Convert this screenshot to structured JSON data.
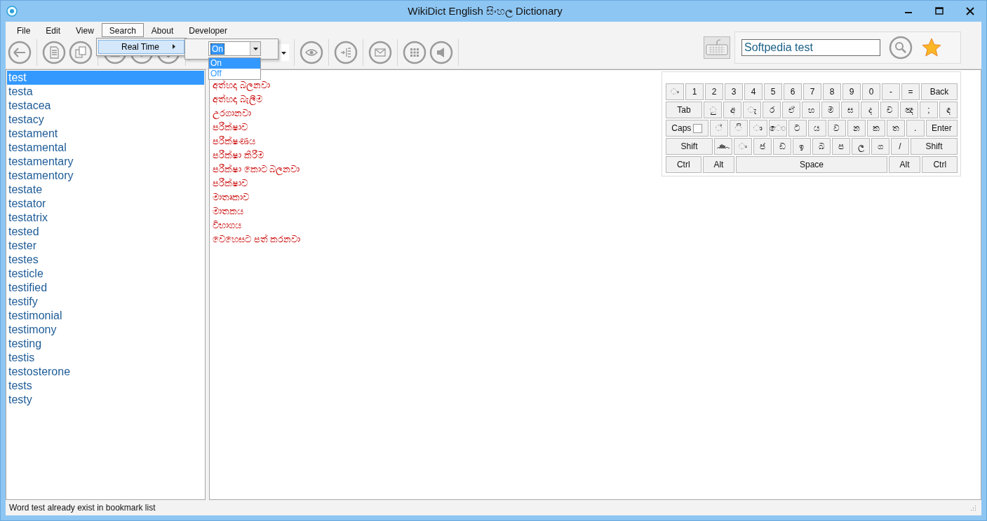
{
  "window": {
    "title": "WikiDict English සිංහල Dictionary"
  },
  "menu": [
    {
      "label": "File",
      "selected": false
    },
    {
      "label": "Edit",
      "selected": false
    },
    {
      "label": "View",
      "selected": false
    },
    {
      "label": "Search",
      "selected": true
    },
    {
      "label": "About",
      "selected": false
    },
    {
      "label": "Developer",
      "selected": false
    }
  ],
  "submenu": [
    {
      "label": "Real Time",
      "selected": true
    }
  ],
  "realtime_combo": {
    "value": "On",
    "options": [
      {
        "label": "On",
        "selected": true
      },
      {
        "label": "Off",
        "selected": false
      }
    ]
  },
  "search": {
    "value": "Softpedia test"
  },
  "words": [
    {
      "text": "test",
      "selected": true
    },
    {
      "text": "testa",
      "selected": false
    },
    {
      "text": "testacea",
      "selected": false
    },
    {
      "text": "testacy",
      "selected": false
    },
    {
      "text": "testament",
      "selected": false
    },
    {
      "text": "testamental",
      "selected": false
    },
    {
      "text": "testamentary",
      "selected": false
    },
    {
      "text": "testamentory",
      "selected": false
    },
    {
      "text": "testate",
      "selected": false
    },
    {
      "text": "testator",
      "selected": false
    },
    {
      "text": "testatrix",
      "selected": false
    },
    {
      "text": "tested",
      "selected": false
    },
    {
      "text": "tester",
      "selected": false
    },
    {
      "text": "testes",
      "selected": false
    },
    {
      "text": "testicle",
      "selected": false
    },
    {
      "text": "testified",
      "selected": false
    },
    {
      "text": "testify",
      "selected": false
    },
    {
      "text": "testimonial",
      "selected": false
    },
    {
      "text": "testimony",
      "selected": false
    },
    {
      "text": "testing",
      "selected": false
    },
    {
      "text": "testis",
      "selected": false
    },
    {
      "text": "testosterone",
      "selected": false
    },
    {
      "text": "tests",
      "selected": false
    },
    {
      "text": "testy",
      "selected": false
    }
  ],
  "translations": [
    "අත්හදා බලනවා",
    "අත්හදා බැලීම",
    "උරගානවා",
    "පරීක්ෂාව",
    "පරීක්ෂණය",
    "පරීක්ෂා කිරීම",
    "පරීක්ෂා කොට බලනවා",
    "පරීක්ෂාව",
    "මාතෘකාව",
    "මාතකය",
    "විභාගය",
    "වෙහෙසට පත් කරනවා"
  ],
  "keyboard": {
    "caps_checked": false,
    "rows": [
      {
        "keys": [
          {
            "kind": "char",
            "label": "◌ං"
          },
          {
            "kind": "char",
            "label": "1"
          },
          {
            "kind": "char",
            "label": "2"
          },
          {
            "kind": "char",
            "label": "3"
          },
          {
            "kind": "char",
            "label": "4"
          },
          {
            "kind": "char",
            "label": "5"
          },
          {
            "kind": "char",
            "label": "6"
          },
          {
            "kind": "char",
            "label": "7"
          },
          {
            "kind": "char",
            "label": "8"
          },
          {
            "kind": "char",
            "label": "9"
          },
          {
            "kind": "char",
            "label": "0"
          },
          {
            "kind": "char",
            "label": "-"
          },
          {
            "kind": "char",
            "label": "="
          },
          {
            "kind": "mod",
            "label": "Back"
          }
        ]
      },
      {
        "keys": [
          {
            "kind": "mod",
            "label": "Tab"
          },
          {
            "kind": "char",
            "label": "◌ු"
          },
          {
            "kind": "char",
            "label": "අ"
          },
          {
            "kind": "char",
            "label": "◌ැ"
          },
          {
            "kind": "char",
            "label": "ර"
          },
          {
            "kind": "char",
            "label": "ඒ"
          },
          {
            "kind": "char",
            "label": "හ"
          },
          {
            "kind": "char",
            "label": "ම"
          },
          {
            "kind": "char",
            "label": "ස"
          },
          {
            "kind": "char",
            "label": "ද"
          },
          {
            "kind": "char",
            "label": "ච"
          },
          {
            "kind": "char",
            "label": "ඤ"
          },
          {
            "kind": "char",
            "label": ";"
          },
          {
            "kind": "char",
            "label": "ඳ"
          }
        ]
      },
      {
        "keys": [
          {
            "kind": "caps",
            "label": "Caps"
          },
          {
            "kind": "char",
            "label": "◌්"
          },
          {
            "kind": "char",
            "label": "◌ි"
          },
          {
            "kind": "char",
            "label": "◌ා"
          },
          {
            "kind": "char",
            "label": "ෙ◌"
          },
          {
            "kind": "char",
            "label": "ට"
          },
          {
            "kind": "char",
            "label": "ය"
          },
          {
            "kind": "char",
            "label": "ව"
          },
          {
            "kind": "char",
            "label": "න"
          },
          {
            "kind": "char",
            "label": "ක"
          },
          {
            "kind": "char",
            "label": "ත"
          },
          {
            "kind": "char",
            "label": "."
          },
          {
            "kind": "mod",
            "label": "Enter"
          }
        ]
      },
      {
        "keys": [
          {
            "kind": "mod",
            "label": "Shift"
          },
          {
            "kind": "squiggle"
          },
          {
            "kind": "char",
            "label": "◌ං"
          },
          {
            "kind": "char",
            "label": "ජ"
          },
          {
            "kind": "char",
            "label": "ඩ"
          },
          {
            "kind": "char",
            "label": "ඉ"
          },
          {
            "kind": "char",
            "label": "බ"
          },
          {
            "kind": "char",
            "label": "ප"
          },
          {
            "kind": "char",
            "label": "ල"
          },
          {
            "kind": "char",
            "label": "ග"
          },
          {
            "kind": "char",
            "label": "/"
          },
          {
            "kind": "mod",
            "label": "Shift"
          }
        ]
      },
      {
        "keys": [
          {
            "kind": "mod",
            "label": "Ctrl"
          },
          {
            "kind": "mod",
            "label": "Alt"
          },
          {
            "kind": "space",
            "label": "Space"
          },
          {
            "kind": "mod",
            "label": "Alt"
          },
          {
            "kind": "mod",
            "label": "Ctrl"
          }
        ]
      }
    ]
  },
  "status_bar": "Word test already exist in bookmark list"
}
